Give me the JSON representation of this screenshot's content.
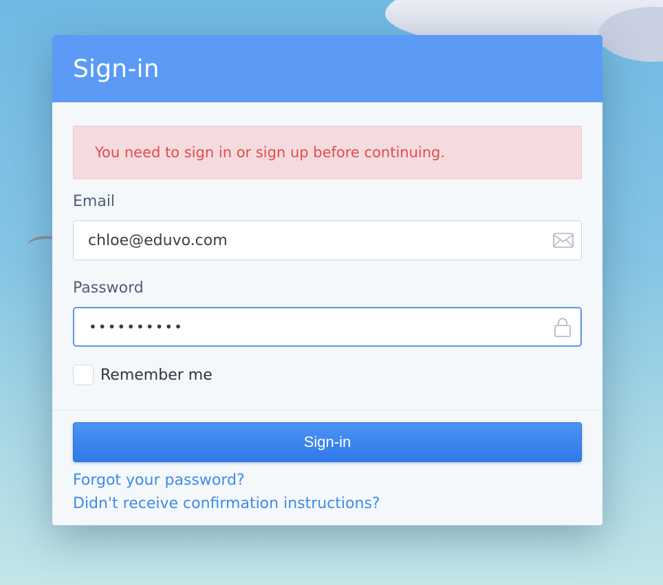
{
  "card": {
    "title": "Sign-in"
  },
  "alert": {
    "message": "You need to sign in or sign up before continuing."
  },
  "email": {
    "label": "Email",
    "value": "chloe@eduvo.com",
    "icon": "envelope-icon"
  },
  "password": {
    "label": "Password",
    "value": "••••••••••",
    "icon": "lock-icon"
  },
  "remember": {
    "label": "Remember me",
    "checked": false
  },
  "actions": {
    "signin_label": "Sign-in",
    "forgot_label": "Forgot your password?",
    "confirm_label": "Didn't receive confirmation instructions?"
  },
  "colors": {
    "header": "#5b9bf6",
    "button": "#3a86f0",
    "alert_text": "#e6484e",
    "alert_bg": "#f4dcde",
    "link": "#3f8ae8"
  }
}
